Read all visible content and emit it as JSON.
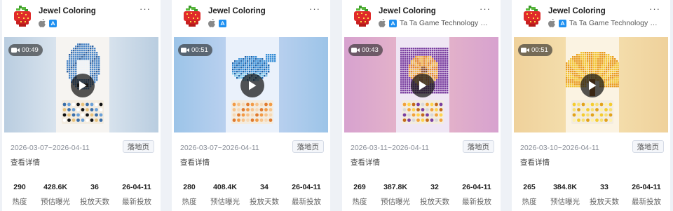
{
  "colors": {
    "page_bg": "#eef1f6",
    "card_bg": "#ffffff",
    "appstore_blue": "#1d8ff0",
    "muted_text": "#8a8f99"
  },
  "stat_labels": [
    "热度",
    "预估曝光",
    "投放天数",
    "最新投放"
  ],
  "cards": [
    {
      "app_name": "Jewel Coloring",
      "developer": "",
      "more": "···",
      "duration": "00:49",
      "date_range": "2026-03-07~2026-04-11",
      "badge": "落地页",
      "detail_link": "查看详情",
      "stats": [
        "290",
        "428.6K",
        "36",
        "26-04-11"
      ],
      "artwork_icon": "penguin-diamond-art",
      "bg_colors": [
        "#b9cde0",
        "#e8eef4"
      ]
    },
    {
      "app_name": "Jewel Coloring",
      "developer": "",
      "more": "···",
      "duration": "00:51",
      "date_range": "2026-03-07~2026-04-11",
      "badge": "落地页",
      "detail_link": "查看详情",
      "stats": [
        "280",
        "408.4K",
        "34",
        "26-04-11"
      ],
      "artwork_icon": "whale-diamond-art",
      "bg_colors": [
        "#9cc4e8",
        "#c7d6f2"
      ]
    },
    {
      "app_name": "Jewel Coloring",
      "developer": "Ta Ta Game Technology Li...",
      "more": "···",
      "duration": "00:43",
      "date_range": "2026-03-11~2026-04-11",
      "badge": "落地页",
      "detail_link": "查看详情",
      "stats": [
        "269",
        "387.8K",
        "32",
        "26-04-11"
      ],
      "artwork_icon": "flower-diamond-art",
      "bg_colors": [
        "#d7a2cf",
        "#e9b9c7"
      ]
    },
    {
      "app_name": "Jewel Coloring",
      "developer": "Ta Ta Game Technology Li...",
      "more": "···",
      "duration": "00:51",
      "date_range": "2026-03-10~2026-04-11",
      "badge": "落地页",
      "detail_link": "查看详情",
      "stats": [
        "265",
        "384.8K",
        "33",
        "26-04-11"
      ],
      "artwork_icon": "fan-diamond-art",
      "bg_colors": [
        "#efd19b",
        "#f6e3b3"
      ]
    }
  ]
}
